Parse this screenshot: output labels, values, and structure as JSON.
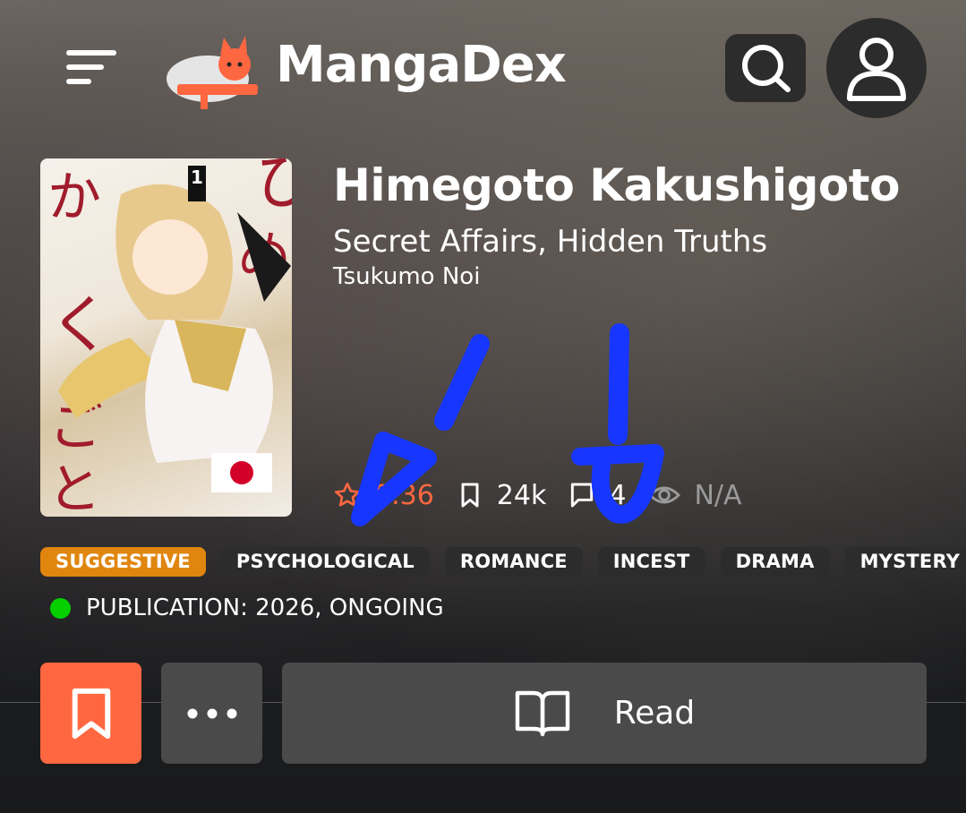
{
  "header": {
    "logo_text": "MangaDex"
  },
  "manga": {
    "title": "Himegoto Kakushigoto",
    "alt_title": "Secret Affairs, Hidden Truths",
    "author": "Tsukumo Noi",
    "cover_flag": "Japan",
    "cover_volume": "1"
  },
  "stats": {
    "rating": "8.36",
    "follows": "24k",
    "comments": "4",
    "views": "N/A"
  },
  "tags": [
    {
      "label": "SUGGESTIVE"
    },
    {
      "label": "PSYCHOLOGICAL"
    },
    {
      "label": "ROMANCE"
    },
    {
      "label": "INCEST"
    },
    {
      "label": "DRAMA"
    },
    {
      "label": "MYSTERY"
    }
  ],
  "publication": {
    "text": "PUBLICATION: 2026, ONGOING",
    "status_color": "#04d000"
  },
  "actions": {
    "read_label": "Read"
  },
  "colors": {
    "accent": "#ff6740",
    "suggestive": "#e0860e",
    "annotation": "#1736ff"
  },
  "icons": [
    "menu-icon",
    "search-icon",
    "user-icon",
    "star-icon",
    "bookmark-icon",
    "comment-icon",
    "eye-icon",
    "more-icon",
    "book-open-icon"
  ]
}
